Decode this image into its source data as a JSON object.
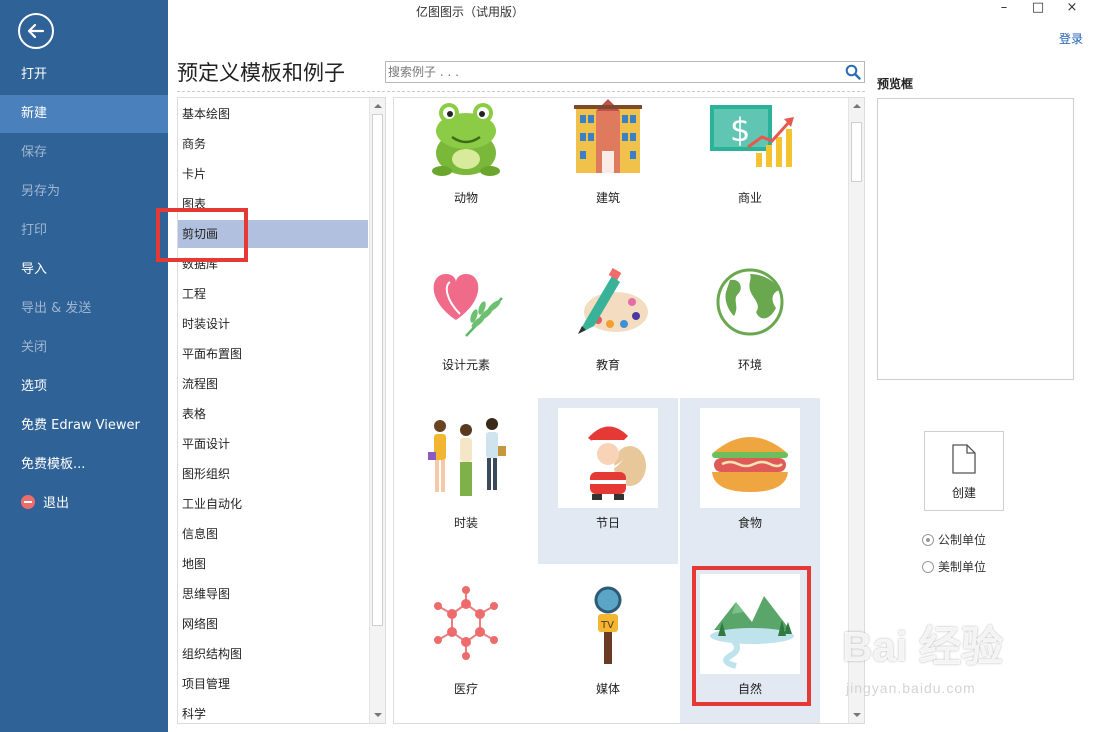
{
  "window": {
    "title": "亿图图示（试用版）",
    "minimize": "–",
    "maximize": "□",
    "close": "×",
    "login": "登录"
  },
  "sidebar": {
    "items": [
      {
        "label": "打开",
        "state": "normal"
      },
      {
        "label": "新建",
        "state": "active"
      },
      {
        "label": "保存",
        "state": "disabled"
      },
      {
        "label": "另存为",
        "state": "disabled"
      },
      {
        "label": "打印",
        "state": "disabled"
      },
      {
        "label": "导入",
        "state": "normal"
      },
      {
        "label": "导出 & 发送",
        "state": "disabled"
      },
      {
        "label": "关闭",
        "state": "disabled"
      },
      {
        "label": "选项",
        "state": "normal"
      },
      {
        "label": "免费 Edraw Viewer",
        "state": "normal"
      },
      {
        "label": "免费模板...",
        "state": "normal"
      },
      {
        "label": "退出",
        "state": "normal"
      }
    ]
  },
  "main": {
    "title": "预定义模板和例子",
    "search_placeholder": "搜索例子 . . ."
  },
  "categories": [
    "基本绘图",
    "商务",
    "卡片",
    "图表",
    "剪切画",
    "数据库",
    "工程",
    "时装设计",
    "平面布置图",
    "流程图",
    "表格",
    "平面设计",
    "图形组织",
    "工业自动化",
    "信息图",
    "地图",
    "思维导图",
    "网络图",
    "组织结构图",
    "项目管理",
    "科学"
  ],
  "selected_category": "剪切画",
  "templates": [
    {
      "label": "动物",
      "icon": "frog-icon"
    },
    {
      "label": "建筑",
      "icon": "building-icon"
    },
    {
      "label": "商业",
      "icon": "business-chart-icon"
    },
    {
      "label": "设计元素",
      "icon": "heart-leaf-icon"
    },
    {
      "label": "教育",
      "icon": "palette-pencil-icon"
    },
    {
      "label": "环境",
      "icon": "globe-icon"
    },
    {
      "label": "时装",
      "icon": "fashion-women-icon"
    },
    {
      "label": "节日",
      "icon": "santa-icon"
    },
    {
      "label": "食物",
      "icon": "burger-icon"
    },
    {
      "label": "医疗",
      "icon": "molecule-icon"
    },
    {
      "label": "媒体",
      "icon": "tv-microphone-icon"
    },
    {
      "label": "自然",
      "icon": "mountain-landscape-icon"
    }
  ],
  "preview": {
    "label": "预览框",
    "create": "创建",
    "units": [
      {
        "label": "公制单位",
        "checked": true
      },
      {
        "label": "美制单位",
        "checked": false
      }
    ]
  },
  "watermark": {
    "text": "Bai 经验",
    "sub": "jingyan.baidu.com"
  }
}
